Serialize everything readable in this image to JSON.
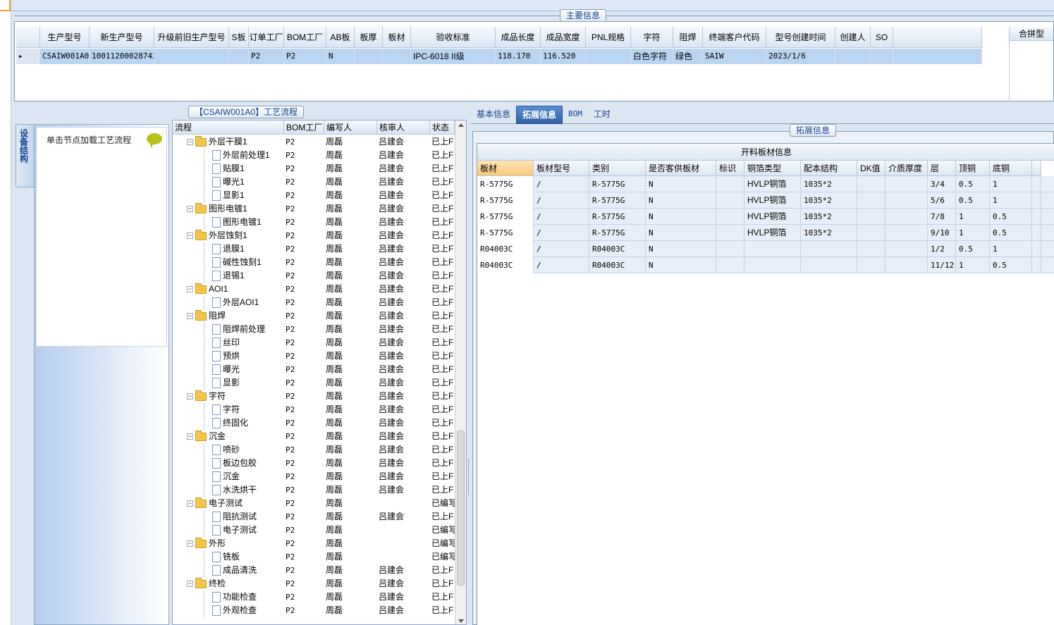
{
  "main_info": {
    "title": "主要信息",
    "columns": [
      "生产型号",
      "新生产型号",
      "升级前旧生产型号",
      "S板",
      "订单工厂",
      "BOM工厂",
      "AB板",
      "板厚",
      "板材",
      "验收标准",
      "成品长度",
      "成品宽度",
      "PNL规格",
      "字符",
      "阻焊",
      "终端客户代码",
      "型号创建时间",
      "创建人",
      "SO"
    ],
    "row": [
      "CSAIW001A0",
      "10011200028742",
      "",
      "",
      "P2",
      "P2",
      "N",
      "",
      "",
      "IPC-6018 II级",
      "118.170",
      "116.520",
      "",
      "白色字符",
      "绿色",
      "SAIW",
      "2023/1/6",
      "",
      ""
    ],
    "side_header": "合拼型"
  },
  "process": {
    "title": "【CSAIW001A0】工艺流程",
    "side_tab": "设备结构",
    "nav_hint": "单击节点加载工艺流程",
    "columns": [
      "流程",
      "BOM工厂",
      "编写人",
      "核审人",
      "状态"
    ],
    "rows": [
      {
        "level": 0,
        "type": "folder",
        "name": "外层干膜1",
        "bom": "P2",
        "writer": "周磊",
        "reviewer": "吕建会",
        "status": "已上F"
      },
      {
        "level": 1,
        "type": "doc",
        "name": "外层前处理1",
        "bom": "P2",
        "writer": "周磊",
        "reviewer": "吕建会",
        "status": "已上F"
      },
      {
        "level": 1,
        "type": "doc",
        "name": "贴膜1",
        "bom": "P2",
        "writer": "周磊",
        "reviewer": "吕建会",
        "status": "已上F"
      },
      {
        "level": 1,
        "type": "doc",
        "name": "曝光1",
        "bom": "P2",
        "writer": "周磊",
        "reviewer": "吕建会",
        "status": "已上F"
      },
      {
        "level": 1,
        "type": "doc",
        "name": "显影1",
        "bom": "P2",
        "writer": "周磊",
        "reviewer": "吕建会",
        "status": "已上F"
      },
      {
        "level": 0,
        "type": "folder",
        "name": "图形电镀1",
        "bom": "P2",
        "writer": "周磊",
        "reviewer": "吕建会",
        "status": "已上F"
      },
      {
        "level": 1,
        "type": "doc",
        "name": "图形电镀1",
        "bom": "P2",
        "writer": "周磊",
        "reviewer": "吕建会",
        "status": "已上F"
      },
      {
        "level": 0,
        "type": "folder",
        "name": "外层蚀刻1",
        "bom": "P2",
        "writer": "周磊",
        "reviewer": "吕建会",
        "status": "已上F"
      },
      {
        "level": 1,
        "type": "doc",
        "name": "退膜1",
        "bom": "P2",
        "writer": "周磊",
        "reviewer": "吕建会",
        "status": "已上F"
      },
      {
        "level": 1,
        "type": "doc",
        "name": "碱性蚀刻1",
        "bom": "P2",
        "writer": "周磊",
        "reviewer": "吕建会",
        "status": "已上F"
      },
      {
        "level": 1,
        "type": "doc",
        "name": "退锡1",
        "bom": "P2",
        "writer": "周磊",
        "reviewer": "吕建会",
        "status": "已上F"
      },
      {
        "level": 0,
        "type": "folder",
        "name": "AOI1",
        "bom": "P2",
        "writer": "周磊",
        "reviewer": "吕建会",
        "status": "已上F"
      },
      {
        "level": 1,
        "type": "doc",
        "name": "外层AOI1",
        "bom": "P2",
        "writer": "周磊",
        "reviewer": "吕建会",
        "status": "已上F"
      },
      {
        "level": 0,
        "type": "folder",
        "name": "阻焊",
        "bom": "P2",
        "writer": "周磊",
        "reviewer": "吕建会",
        "status": "已上F"
      },
      {
        "level": 1,
        "type": "doc",
        "name": "阻焊前处理",
        "bom": "P2",
        "writer": "周磊",
        "reviewer": "吕建会",
        "status": "已上F"
      },
      {
        "level": 1,
        "type": "doc",
        "name": "丝印",
        "bom": "P2",
        "writer": "周磊",
        "reviewer": "吕建会",
        "status": "已上F"
      },
      {
        "level": 1,
        "type": "doc",
        "name": "预烘",
        "bom": "P2",
        "writer": "周磊",
        "reviewer": "吕建会",
        "status": "已上F"
      },
      {
        "level": 1,
        "type": "doc",
        "name": "曝光",
        "bom": "P2",
        "writer": "周磊",
        "reviewer": "吕建会",
        "status": "已上F"
      },
      {
        "level": 1,
        "type": "doc",
        "name": "显影",
        "bom": "P2",
        "writer": "周磊",
        "reviewer": "吕建会",
        "status": "已上F"
      },
      {
        "level": 0,
        "type": "folder",
        "name": "字符",
        "bom": "P2",
        "writer": "周磊",
        "reviewer": "吕建会",
        "status": "已上F"
      },
      {
        "level": 1,
        "type": "doc",
        "name": "字符",
        "bom": "P2",
        "writer": "周磊",
        "reviewer": "吕建会",
        "status": "已上F"
      },
      {
        "level": 1,
        "type": "doc",
        "name": "终固化",
        "bom": "P2",
        "writer": "周磊",
        "reviewer": "吕建会",
        "status": "已上F"
      },
      {
        "level": 0,
        "type": "folder",
        "name": "沉金",
        "bom": "P2",
        "writer": "周磊",
        "reviewer": "吕建会",
        "status": "已上F"
      },
      {
        "level": 1,
        "type": "doc",
        "name": "喷砂",
        "bom": "P2",
        "writer": "周磊",
        "reviewer": "吕建会",
        "status": "已上F"
      },
      {
        "level": 1,
        "type": "doc",
        "name": "板边包胶",
        "bom": "P2",
        "writer": "周磊",
        "reviewer": "吕建会",
        "status": "已上F"
      },
      {
        "level": 1,
        "type": "doc",
        "name": "沉金",
        "bom": "P2",
        "writer": "周磊",
        "reviewer": "吕建会",
        "status": "已上F"
      },
      {
        "level": 1,
        "type": "doc",
        "name": "水洗烘干",
        "bom": "P2",
        "writer": "周磊",
        "reviewer": "吕建会",
        "status": "已上F"
      },
      {
        "level": 0,
        "type": "folder",
        "name": "电子测试",
        "bom": "P2",
        "writer": "周磊",
        "reviewer": "",
        "status": "已编写"
      },
      {
        "level": 1,
        "type": "doc",
        "name": "阻抗测试",
        "bom": "P2",
        "writer": "周磊",
        "reviewer": "吕建会",
        "status": "已上F"
      },
      {
        "level": 1,
        "type": "doc",
        "name": "电子测试",
        "bom": "P2",
        "writer": "周磊",
        "reviewer": "",
        "status": "已编写"
      },
      {
        "level": 0,
        "type": "folder",
        "name": "外形",
        "bom": "P2",
        "writer": "周磊",
        "reviewer": "",
        "status": "已编写"
      },
      {
        "level": 1,
        "type": "doc",
        "name": "铣板",
        "bom": "P2",
        "writer": "周磊",
        "reviewer": "",
        "status": "已编写"
      },
      {
        "level": 1,
        "type": "doc",
        "name": "成品清洗",
        "bom": "P2",
        "writer": "周磊",
        "reviewer": "吕建会",
        "status": "已上F"
      },
      {
        "level": 0,
        "type": "folder",
        "name": "终检",
        "bom": "P2",
        "writer": "周磊",
        "reviewer": "吕建会",
        "status": "已上F"
      },
      {
        "level": 1,
        "type": "doc",
        "name": "功能检查",
        "bom": "P2",
        "writer": "周磊",
        "reviewer": "吕建会",
        "status": "已上F"
      },
      {
        "level": 1,
        "type": "doc",
        "name": "外观检查",
        "bom": "P2",
        "writer": "周磊",
        "reviewer": "吕建会",
        "status": "已上F"
      }
    ]
  },
  "detail": {
    "tabs": [
      "基本信息",
      "拓展信息",
      "BOM",
      "工时"
    ],
    "active_tab": 1,
    "group_title": "拓展信息",
    "table_title": "开料板材信息",
    "columns": [
      "板材",
      "板材型号",
      "类别",
      "是否客供板材",
      "标识",
      "铜箔类型",
      "配本结构",
      "DK值",
      "介质厚度",
      "层",
      "顶铜",
      "底铜"
    ],
    "rows": [
      [
        "R-5775G",
        "/",
        "R-5775G",
        "N",
        "",
        "HVLP铜箔",
        "1035*2",
        "",
        "",
        "3/4",
        "0.5",
        "1"
      ],
      [
        "R-5775G",
        "/",
        "R-5775G",
        "N",
        "",
        "HVLP铜箔",
        "1035*2",
        "",
        "",
        "5/6",
        "0.5",
        "1"
      ],
      [
        "R-5775G",
        "/",
        "R-5775G",
        "N",
        "",
        "HVLP铜箔",
        "1035*2",
        "",
        "",
        "7/8",
        "1",
        "0.5"
      ],
      [
        "R-5775G",
        "/",
        "R-5775G",
        "N",
        "",
        "HVLP铜箔",
        "1035*2",
        "",
        "",
        "9/10",
        "1",
        "0.5"
      ],
      [
        "R04003C",
        "/",
        "R04003C",
        "N",
        "",
        "",
        "",
        "",
        "",
        "1/2",
        "0.5",
        "1"
      ],
      [
        "R04003C",
        "/",
        "R04003C",
        "N",
        "",
        "",
        "",
        "",
        "",
        "11/12",
        "1",
        "0.5"
      ]
    ]
  }
}
